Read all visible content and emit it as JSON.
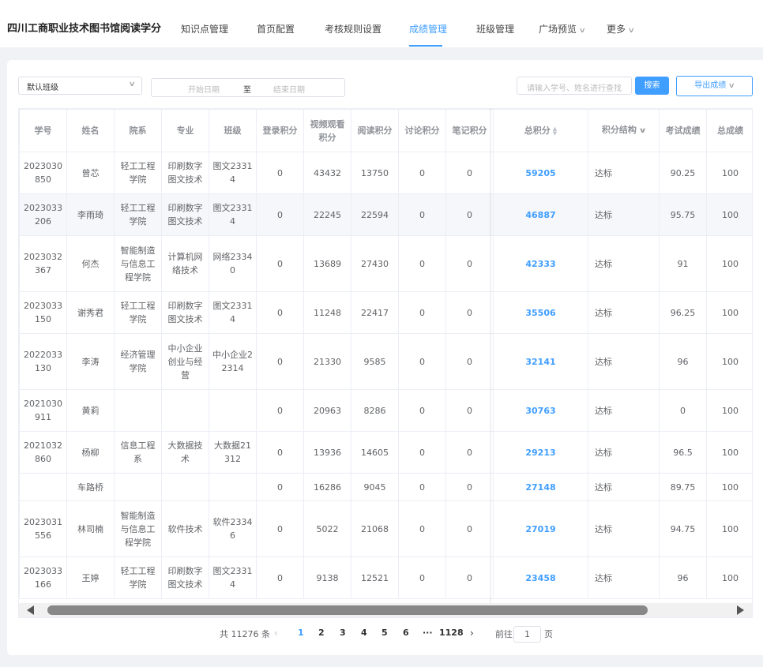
{
  "header": {
    "brand": "四川工商职业技术图书馆阅读学分",
    "nav": [
      {
        "label": "知识点管理"
      },
      {
        "label": "首页配置"
      },
      {
        "label": "考核规则设置"
      },
      {
        "label": "成绩管理"
      },
      {
        "label": "班级管理"
      },
      {
        "label": "广场预览"
      },
      {
        "label": "更多"
      }
    ],
    "active_nav": "成绩管理",
    "accent": "#409eff"
  },
  "filters": {
    "class_select": "默认班级",
    "date_start_placeholder": "开始日期",
    "date_sep": "至",
    "date_end_placeholder": "结束日期",
    "search_placeholder": "请输入学号、姓名进行查找",
    "search_button": "搜索",
    "export_button": "导出成绩"
  },
  "table": {
    "columns": [
      "学号",
      "姓名",
      "院系",
      "专业",
      "班级",
      "登录积分",
      "视频观看积分",
      "阅读积分",
      "讨论积分",
      "笔记积分",
      "总积分",
      "积分结构",
      "考试成绩",
      "总成绩"
    ],
    "rows": [
      [
        "2023030850",
        "曾芯",
        "轻工工程学院",
        "印刷数字图文技术",
        "图文23314",
        "0",
        "43432",
        "13750",
        "0",
        "0",
        "59205",
        "达标",
        "90.25",
        "100"
      ],
      [
        "2023033206",
        "李雨琦",
        "轻工工程学院",
        "印刷数字图文技术",
        "图文23314",
        "0",
        "22245",
        "22594",
        "0",
        "0",
        "46887",
        "达标",
        "95.75",
        "100"
      ],
      [
        "2023032367",
        "何杰",
        "智能制造与信息工程学院",
        "计算机网络技术",
        "网络23340",
        "0",
        "13689",
        "27430",
        "0",
        "0",
        "42333",
        "达标",
        "91",
        "100"
      ],
      [
        "2023033150",
        "谢秀君",
        "轻工工程学院",
        "印刷数字图文技术",
        "图文23314",
        "0",
        "11248",
        "22417",
        "0",
        "0",
        "35506",
        "达标",
        "96.25",
        "100"
      ],
      [
        "2022033130",
        "李涛",
        "经济管理学院",
        "中小企业创业与经营",
        "中小企业22314",
        "0",
        "21330",
        "9585",
        "0",
        "0",
        "32141",
        "达标",
        "96",
        "100"
      ],
      [
        "2021030911",
        "黄莉",
        "",
        "",
        "",
        "0",
        "20963",
        "8286",
        "0",
        "0",
        "30763",
        "达标",
        "0",
        "100"
      ],
      [
        "2021032860",
        "杨柳",
        "信息工程系",
        "大数据技术",
        "大数据21312",
        "0",
        "13936",
        "14605",
        "0",
        "0",
        "29213",
        "达标",
        "96.5",
        "100"
      ],
      [
        "",
        "车路桥",
        "",
        "",
        "",
        "0",
        "16286",
        "9045",
        "0",
        "0",
        "27148",
        "达标",
        "89.75",
        "100"
      ],
      [
        "2023031556",
        "林司楠",
        "智能制造与信息工程学院",
        "软件技术",
        "软件23346",
        "0",
        "5022",
        "21068",
        "0",
        "0",
        "27019",
        "达标",
        "94.75",
        "100"
      ],
      [
        "2023033166",
        "王婷",
        "轻工工程学院",
        "印刷数字图文技术",
        "图文23314",
        "0",
        "9138",
        "12521",
        "0",
        "0",
        "23458",
        "达标",
        "96",
        "100"
      ]
    ]
  },
  "pagination": {
    "total": "共 11276 条",
    "pages": [
      "1",
      "2",
      "3",
      "4",
      "5",
      "6",
      "···",
      "1128"
    ],
    "current": "1",
    "goto_label": "前往",
    "goto_value": "1",
    "page_unit": "页"
  }
}
